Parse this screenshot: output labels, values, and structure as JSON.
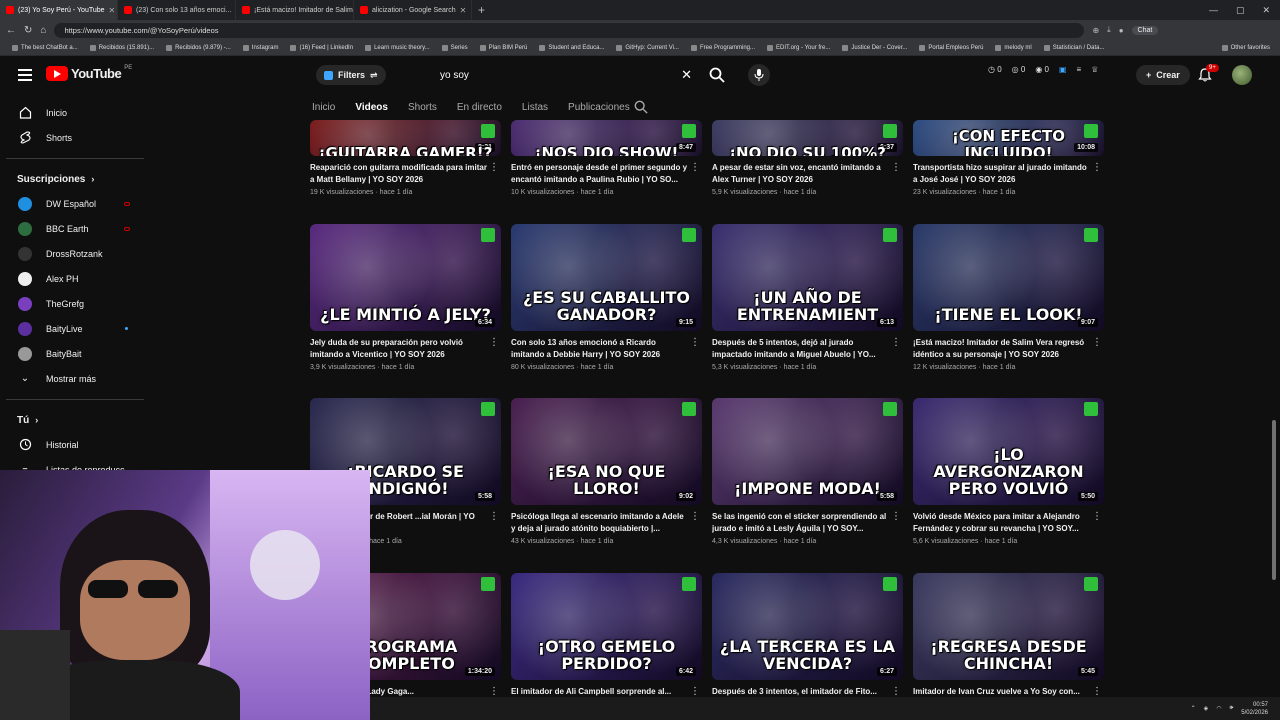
{
  "browser": {
    "tabs": [
      {
        "label": "(23) Yo Soy Perú - YouTube",
        "active": true
      },
      {
        "label": "(23) Con solo 13 años emoci...",
        "active": false
      },
      {
        "label": "¡Está macizo! Imitador de Salim V...",
        "active": false
      },
      {
        "label": "alicization - Google Search",
        "active": false
      }
    ],
    "url": "https://www.youtube.com/@YoSoyPerú/videos",
    "chat_label": "Chat",
    "bookmarks": [
      "The best ChatBot a...",
      "Recibidos (15.891)...",
      "Recibidos (9.879) -...",
      "Instagram",
      "(16) Feed | LinkedIn",
      "Learn music theory...",
      "Series",
      "Plan BIM Perú",
      "Student and Educa...",
      "GitHyp: Current Vi...",
      "Free Programming...",
      "EDIT.org - Your fre...",
      "Justice Der - Cover...",
      "Portal Empleos Perú",
      "melody ml",
      "Statistician / Data..."
    ],
    "other_favorites": "Other favorites"
  },
  "header": {
    "logo_text": "YouTube",
    "region": "PE",
    "filters_label": "Filters",
    "search_value": "yo soy",
    "counters": [
      "0",
      "0",
      "0"
    ],
    "create_label": "Crear",
    "notifications": "9+"
  },
  "channel_tabs": [
    "Inicio",
    "Videos",
    "Shorts",
    "En directo",
    "Listas",
    "Publicaciones"
  ],
  "sidebar": {
    "main": [
      {
        "label": "Inicio",
        "icon": "home-icon"
      },
      {
        "label": "Shorts",
        "icon": "shorts-icon"
      }
    ],
    "subs_title": "Suscripciones",
    "subs": [
      {
        "label": "DW Español",
        "color": "#1f8fe0",
        "live": true
      },
      {
        "label": "BBC Earth",
        "color": "#2c6e3f",
        "live": true
      },
      {
        "label": "DrossRotzank",
        "color": "#333333",
        "live": false
      },
      {
        "label": "Alex PH",
        "color": "#eeeeee",
        "live": false
      },
      {
        "label": "TheGrefg",
        "color": "#7a3fbf",
        "live": false
      },
      {
        "label": "BaityLive",
        "color": "#5b2fa0",
        "dot": true
      },
      {
        "label": "BaityBait",
        "color": "#999999",
        "live": false
      }
    ],
    "more_label": "Mostrar más",
    "you_title": "Tú",
    "you": [
      {
        "label": "Historial"
      },
      {
        "label": "Listas de reproducc..."
      }
    ]
  },
  "videos": [
    {
      "caption": "¡GUITARRA GAMER!?",
      "duration": "8:21",
      "title": "Reaparició con guitarra modificada para imitar a Matt Bellamy | YO SOY 2026",
      "stats": "19 K visualizaciones · hace 1 día",
      "bg": "#7a1a1a"
    },
    {
      "caption": "¡NOS DIO SHOW!",
      "duration": "8:47",
      "title": "Entró en personaje desde el primer segundo y encantó imitando a Paulina Rubio | YO SO...",
      "stats": "10 K visualizaciones · hace 1 día",
      "bg": "#4a2a70"
    },
    {
      "caption": "¡NO DIO SU 100%?",
      "duration": "6:37",
      "title": "A pesar de estar sin voz, encantó imitando a Alex Turner | YO SOY 2026",
      "stats": "5,9 K visualizaciones · hace 1 día",
      "bg": "#3a3a60"
    },
    {
      "caption": "¡CON EFECTO INCLUIDO!",
      "duration": "10:08",
      "title": "Transportista hizo suspirar al jurado imitando a José José | YO SOY 2026",
      "stats": "23 K visualizaciones · hace 1 día",
      "bg": "#2a4a80"
    },
    {
      "caption": "¿LE MINTIÓ A JELY?",
      "duration": "6:34",
      "title": "Jely duda de su preparación pero volvió imitando a Vicentico | YO SOY 2026",
      "stats": "3,9 K visualizaciones · hace 1 día",
      "bg": "#5a2a80"
    },
    {
      "caption": "¿ES SU CABALLITO GANADOR?",
      "duration": "9:15",
      "title": "Con solo 13 años emocionó a Ricardo imitando a Debbie Harry | YO SOY 2026",
      "stats": "80 K visualizaciones · hace 1 día",
      "bg": "#2a3a70"
    },
    {
      "caption": "¡UN AÑO DE ENTRENAMIENT",
      "duration": "6:13",
      "title": "Después de 5 intentos, dejó al jurado impactado imitando a Miguel Abuelo | YO...",
      "stats": "5,3 K visualizaciones · hace 1 día",
      "bg": "#3a3070"
    },
    {
      "caption": "¡TIENE EL LOOK!",
      "duration": "9:07",
      "title": "¡Está macizo! Imitador de Salim Vera regresó idéntico a su personaje | YO SOY 2026",
      "stats": "12 K visualizaciones · hace 1 día",
      "bg": "#2a3a6a"
    },
    {
      "caption": "¡RICARDO SE INDIGNÓ!",
      "duration": "5:58",
      "title": "...a este imitador de Robert ...ial Morán | YO SOY 2026",
      "stats": "...visualizaciones · hace 1 día",
      "bg": "#2a2a50"
    },
    {
      "caption": "¡ESA NO QUE LLORO!",
      "duration": "9:02",
      "title": "Psicóloga llega al escenario imitando a Adele y deja al jurado atónito boquiabierto |...",
      "stats": "43 K visualizaciones · hace 1 día",
      "bg": "#4a2050"
    },
    {
      "caption": "¡IMPONE MODA!",
      "duration": "5:58",
      "title": "Se las ingenió con el sticker sorprendiendo al jurado e imitó a Lesly Águila | YO SOY...",
      "stats": "4,3 K visualizaciones · hace 1 día",
      "bg": "#5a3a70"
    },
    {
      "caption": "¡LO AVERGONZARON PERO VOLVIÓ",
      "duration": "5:50",
      "title": "Volvió desde México para imitar a Alejandro Fernández y cobrar su revancha | YO SOY...",
      "stats": "5,6 K visualizaciones · hace 1 día",
      "bg": "#3a2a70"
    },
    {
      "caption": "PROGRAMA COMPLETO",
      "duration": "1:34:20",
      "title": "...Li Campbell, Lady Gaga...",
      "stats": "",
      "bg": "#5a1a4a"
    },
    {
      "caption": "¡OTRO GEMELO PERDIDO?",
      "duration": "6:42",
      "title": "El imitador de Ali Campbell sorprende al...",
      "stats": "",
      "bg": "#3a2a80"
    },
    {
      "caption": "¿LA TERCERA ES LA VENCIDA?",
      "duration": "6:27",
      "title": "Después de 3 intentos, el imitador de Fito...",
      "stats": "",
      "bg": "#2a2a60"
    },
    {
      "caption": "¡REGRESA DESDE CHINCHA!",
      "duration": "5:45",
      "title": "Imitador de Ivan Cruz vuelve a Yo Soy con...",
      "stats": "",
      "bg": "#3a3a60"
    }
  ],
  "taskbar": {
    "time": "00:57",
    "date": "5/02/2026"
  }
}
